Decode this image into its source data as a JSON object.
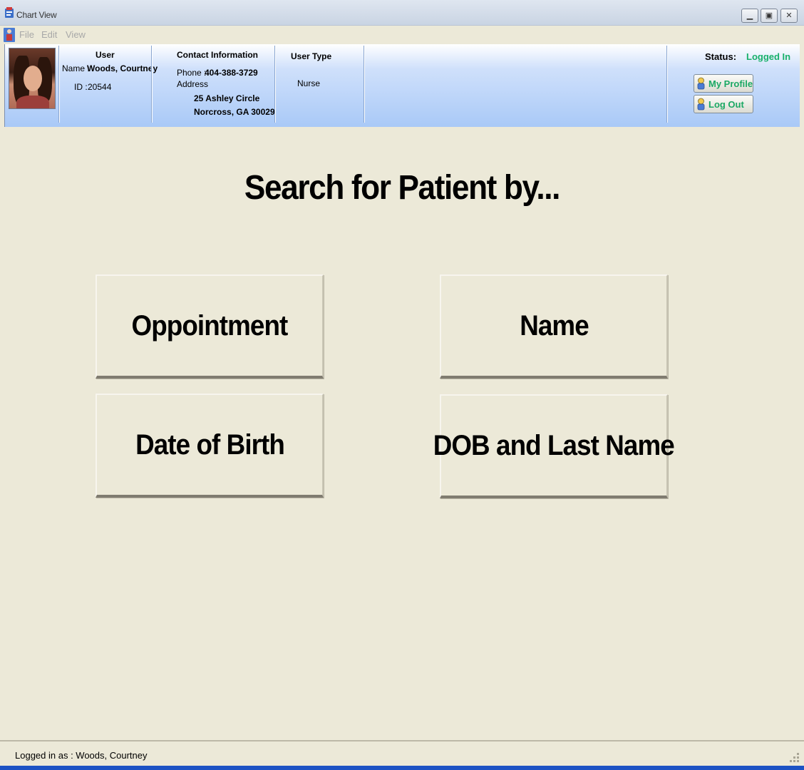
{
  "window": {
    "title": "Chart View",
    "minimize": "▁",
    "restore": "▣",
    "close": "✕"
  },
  "menu": {
    "items": [
      "File",
      "Edit",
      "View"
    ]
  },
  "header": {
    "user": {
      "heading": "User",
      "name_label": "Name :",
      "name_value": "Woods, Courtney",
      "id_label": "ID :",
      "id_value": "20544"
    },
    "contact": {
      "heading": "Contact Information",
      "phone_label": "Phone :",
      "phone_value": "404-388-3729",
      "address_label": "Address",
      "address_line1": "25 Ashley Circle",
      "address_line2": "Norcross, GA 30029"
    },
    "user_type": {
      "heading": "User Type",
      "value": "Nurse"
    },
    "status": {
      "label": "Status:",
      "value": "Logged In"
    },
    "buttons": {
      "my_profile": "My Profile",
      "log_out": "Log Out"
    }
  },
  "main": {
    "title": "Search for Patient by...",
    "options": {
      "appointment": "Oppointment",
      "name": "Name",
      "dob": "Date of Birth",
      "dob_last_name": "DOB and Last Name"
    }
  },
  "statusbar": {
    "text": "Logged in as : Woods, Courtney"
  },
  "colors": {
    "status_green": "#18b06a",
    "header_blue": "#a9c9f7",
    "background": "#ece9d8"
  }
}
